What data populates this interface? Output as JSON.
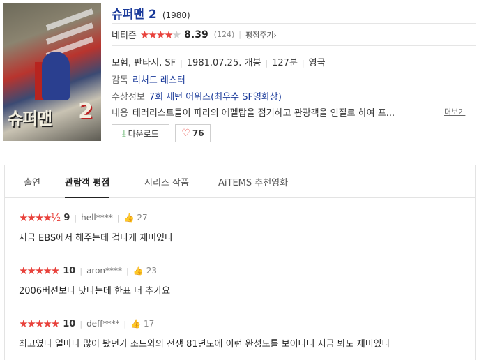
{
  "movie": {
    "title": "슈퍼맨 2",
    "year": "(1980)",
    "netizen_label": "네티즌",
    "stars_full": "★★★★",
    "stars_empty": "★",
    "score": "8.39",
    "rating_count": "(124)",
    "review_link": "평점주기›",
    "genre_line": "모험, 판타지, SF",
    "release": "1981.07.25. 개봉",
    "runtime": "127분",
    "country": "영국",
    "director_label": "감독",
    "director": "리처드 레스터",
    "award_label": "수상정보",
    "award": "7회 새턴 어워즈(최우수 SF영화상)",
    "plot_label": "내용",
    "plot": "테러리스트들이 파리의 에펠탑을 점거하고 관광객을 인질로 하여 프...",
    "more_label": "더보기",
    "download_label": "다운로드",
    "like_count": "76",
    "poster_title": "슈퍼맨",
    "poster_num": "2"
  },
  "tabs": [
    "출연",
    "관람객 평점",
    "시리즈 작품",
    "AiTEMS 추천영화"
  ],
  "active_tab": 1,
  "reviews": [
    {
      "stars": "★★★★½",
      "score": "9",
      "user": "hell****",
      "likes": "27",
      "text": "지금 EBS에서 해주는데 겁나게 재미있다"
    },
    {
      "stars": "★★★★★",
      "score": "10",
      "user": "aron****",
      "likes": "23",
      "text": "2006버젼보다 낫다는데 한표 더 추가요"
    },
    {
      "stars": "★★★★★",
      "score": "10",
      "user": "deff****",
      "likes": "17",
      "text": "최고였다 얼마나 많이 봤던가 조드와의 전쟁 81년도에 이런 완성도를 보이다니 지금 봐도 재미있다"
    }
  ],
  "colors": {
    "accent": "#1a3a9a",
    "star": "#e8413b"
  }
}
